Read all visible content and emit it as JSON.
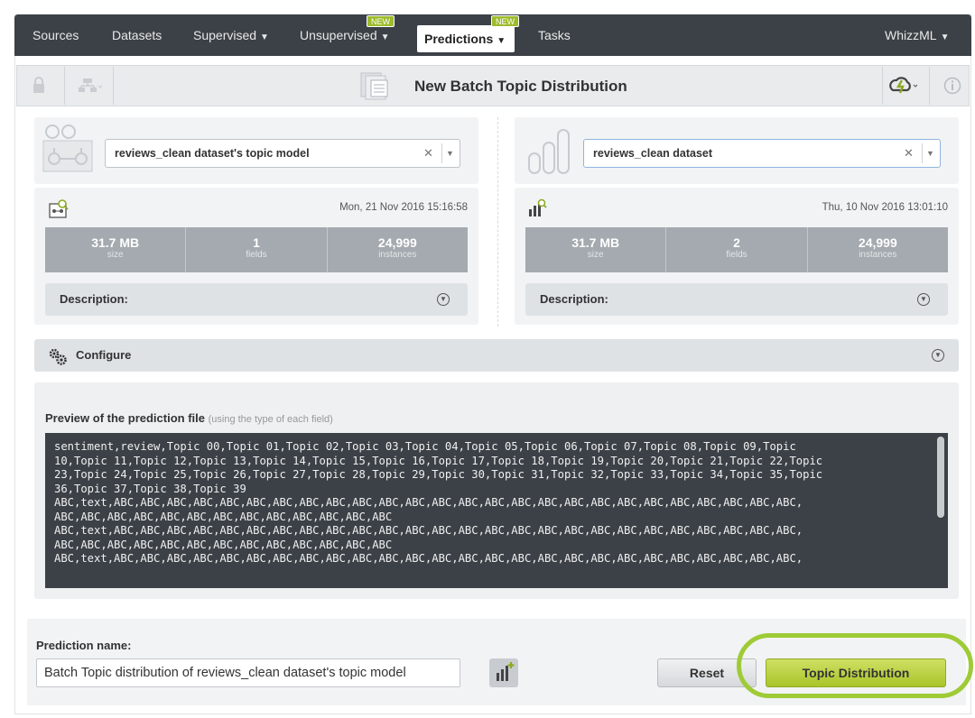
{
  "nav": {
    "sources": "Sources",
    "datasets": "Datasets",
    "supervised": "Supervised",
    "unsupervised": "Unsupervised",
    "predictions": "Predictions",
    "tasks": "Tasks",
    "whizzml": "WhizzML",
    "new_badge": "NEW"
  },
  "title": "New Batch Topic Distribution",
  "model_panel": {
    "selected": "reviews_clean dataset's topic model",
    "date": "Mon, 21 Nov 2016 15:16:58",
    "stats": [
      {
        "value": "31.7 MB",
        "label": "size"
      },
      {
        "value": "1",
        "label": "fields"
      },
      {
        "value": "24,999",
        "label": "instances"
      }
    ],
    "description_label": "Description:"
  },
  "dataset_panel": {
    "selected": "reviews_clean dataset",
    "date": "Thu, 10 Nov 2016 13:01:10",
    "stats": [
      {
        "value": "31.7 MB",
        "label": "size"
      },
      {
        "value": "2",
        "label": "fields"
      },
      {
        "value": "24,999",
        "label": "instances"
      }
    ],
    "description_label": "Description:"
  },
  "configure_label": "Configure",
  "preview": {
    "title": "Preview of the prediction file",
    "subtitle": "(using the type of each field)",
    "lines": [
      "sentiment,review,Topic 00,Topic 01,Topic 02,Topic 03,Topic 04,Topic 05,Topic 06,Topic 07,Topic 08,Topic 09,Topic",
      "10,Topic 11,Topic 12,Topic 13,Topic 14,Topic 15,Topic 16,Topic 17,Topic 18,Topic 19,Topic 20,Topic 21,Topic 22,Topic",
      "23,Topic 24,Topic 25,Topic 26,Topic 27,Topic 28,Topic 29,Topic 30,Topic 31,Topic 32,Topic 33,Topic 34,Topic 35,Topic",
      "36,Topic 37,Topic 38,Topic 39",
      "ABC,text,ABC,ABC,ABC,ABC,ABC,ABC,ABC,ABC,ABC,ABC,ABC,ABC,ABC,ABC,ABC,ABC,ABC,ABC,ABC,ABC,ABC,ABC,ABC,ABC,ABC,ABC,",
      "ABC,ABC,ABC,ABC,ABC,ABC,ABC,ABC,ABC,ABC,ABC,ABC,ABC",
      "ABC,text,ABC,ABC,ABC,ABC,ABC,ABC,ABC,ABC,ABC,ABC,ABC,ABC,ABC,ABC,ABC,ABC,ABC,ABC,ABC,ABC,ABC,ABC,ABC,ABC,ABC,ABC,",
      "ABC,ABC,ABC,ABC,ABC,ABC,ABC,ABC,ABC,ABC,ABC,ABC,ABC",
      "ABC,text,ABC,ABC,ABC,ABC,ABC,ABC,ABC,ABC,ABC,ABC,ABC,ABC,ABC,ABC,ABC,ABC,ABC,ABC,ABC,ABC,ABC,ABC,ABC,ABC,ABC,ABC,"
    ]
  },
  "prediction_name": {
    "label": "Prediction name:",
    "value": "Batch Topic distribution of reviews_clean dataset's topic model"
  },
  "buttons": {
    "reset": "Reset",
    "go": "Topic Distribution"
  },
  "colors": {
    "accent": "#a9c42a",
    "highlight_ring": "#9ecb36",
    "nav_bg": "#3c4147"
  }
}
